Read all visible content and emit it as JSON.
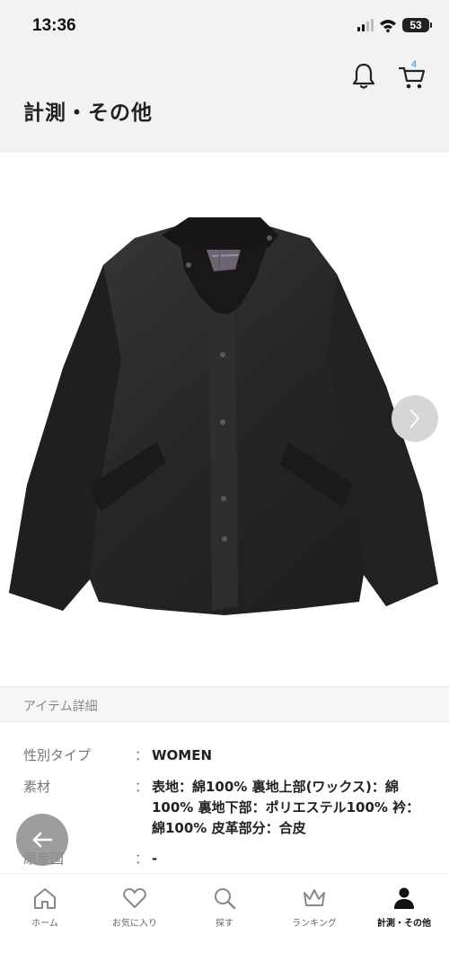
{
  "status_bar": {
    "time": "13:36",
    "battery": "53"
  },
  "header": {
    "title": "計測・その他",
    "cart_count": "4"
  },
  "details": {
    "section_title": "アイテム詳細",
    "rows": [
      {
        "label": "性別タイプ",
        "colon": "：",
        "value": "WOMEN"
      },
      {
        "label": "素材",
        "colon": "：",
        "value": "表地：綿100% 裏地上部(ワックス)：綿100% 裏地下部：ポリエステル100% 衿：綿100% 皮革部分：合皮"
      },
      {
        "label": "原産国",
        "colon": "：",
        "value": "-"
      }
    ]
  },
  "tab_bar": {
    "items": [
      {
        "label": "ホーム",
        "icon": "home-icon"
      },
      {
        "label": "お気に入り",
        "icon": "heart-icon"
      },
      {
        "label": "探す",
        "icon": "search-icon"
      },
      {
        "label": "ランキング",
        "icon": "crown-icon"
      },
      {
        "label": "計測・その他",
        "icon": "person-icon"
      }
    ]
  },
  "colors": {
    "header_bg": "#f2f2f2",
    "accent": "#3a8ed6",
    "jacket": "#2b2b2b"
  }
}
